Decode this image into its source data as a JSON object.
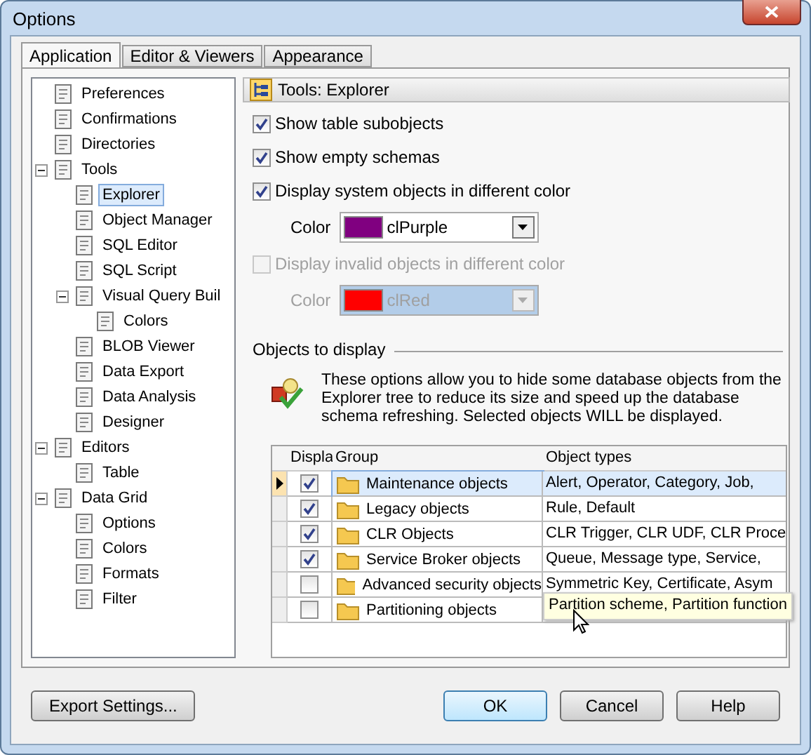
{
  "window": {
    "title": "Options"
  },
  "tabs": [
    {
      "label": "Application",
      "selected": true
    },
    {
      "label": "Editor & Viewers",
      "selected": false
    },
    {
      "label": "Appearance",
      "selected": false
    }
  ],
  "tree": [
    {
      "label": "Preferences",
      "selected": false
    },
    {
      "label": "Confirmations",
      "selected": false
    },
    {
      "label": "Directories",
      "selected": false
    },
    {
      "label": "Tools",
      "selected": false,
      "expanded": true,
      "children": [
        {
          "label": "Explorer",
          "selected": true
        },
        {
          "label": "Object Manager",
          "selected": false
        },
        {
          "label": "SQL Editor",
          "selected": false
        },
        {
          "label": "SQL Script",
          "selected": false
        },
        {
          "label": "Visual Query Buil",
          "selected": false,
          "expanded": true,
          "children": [
            {
              "label": "Colors",
              "selected": false
            }
          ]
        },
        {
          "label": "BLOB Viewer",
          "selected": false
        },
        {
          "label": "Data Export",
          "selected": false
        },
        {
          "label": "Data Analysis",
          "selected": false
        },
        {
          "label": "Designer",
          "selected": false
        }
      ]
    },
    {
      "label": "Editors",
      "selected": false,
      "expanded": true,
      "children": [
        {
          "label": "Table",
          "selected": false
        }
      ]
    },
    {
      "label": "Data Grid",
      "selected": false,
      "expanded": true,
      "children": [
        {
          "label": "Options",
          "selected": false
        },
        {
          "label": "Colors",
          "selected": false
        },
        {
          "label": "Formats",
          "selected": false
        },
        {
          "label": "Filter",
          "selected": false
        }
      ]
    }
  ],
  "header": "Tools: Explorer",
  "options": [
    {
      "kind": "check",
      "label": "Show table subobjects",
      "checked": true,
      "disabled": false
    },
    {
      "kind": "check",
      "label": "Show empty schemas",
      "checked": true,
      "disabled": false
    },
    {
      "kind": "check",
      "label": "Display system objects in different color",
      "checked": true,
      "disabled": false
    },
    {
      "kind": "color",
      "label": "Color",
      "value": "clPurple",
      "color": "#800080",
      "disabled": false
    },
    {
      "kind": "check",
      "label": "Display invalid objects in different color",
      "checked": false,
      "disabled": true
    },
    {
      "kind": "color",
      "label": "Color",
      "value": "clRed",
      "color": "#ff0000",
      "disabled": true
    }
  ],
  "objects_group": {
    "title": "Objects to display",
    "description": "These options allow you to hide some database objects from the Explorer tree to reduce its size and speed up the database schema refreshing. Selected objects WILL be displayed."
  },
  "table": {
    "columns": [
      "Displa",
      "Group",
      "Object types"
    ],
    "rows": [
      {
        "checked": true,
        "selected": true,
        "group": "Maintenance objects",
        "types": "Alert, Operator, Category, Job,"
      },
      {
        "checked": true,
        "selected": false,
        "group": "Legacy objects",
        "types": "Rule, Default"
      },
      {
        "checked": true,
        "selected": false,
        "group": "CLR Objects",
        "types": "CLR Trigger, CLR UDF, CLR Proce"
      },
      {
        "checked": true,
        "selected": false,
        "group": "Service Broker objects",
        "types": "Queue, Message type, Service,"
      },
      {
        "checked": false,
        "selected": false,
        "group": "Advanced security objects",
        "types": "Symmetric Key, Certificate, Asym"
      },
      {
        "checked": false,
        "selected": false,
        "group": "Partitioning objects",
        "types": ""
      }
    ],
    "tooltip": "Partition scheme, Partition function"
  },
  "buttons": [
    {
      "label": "Export Settings...",
      "default": false
    },
    {
      "label": "OK",
      "default": true
    },
    {
      "label": "Cancel",
      "default": false
    },
    {
      "label": "Help",
      "default": false
    }
  ]
}
